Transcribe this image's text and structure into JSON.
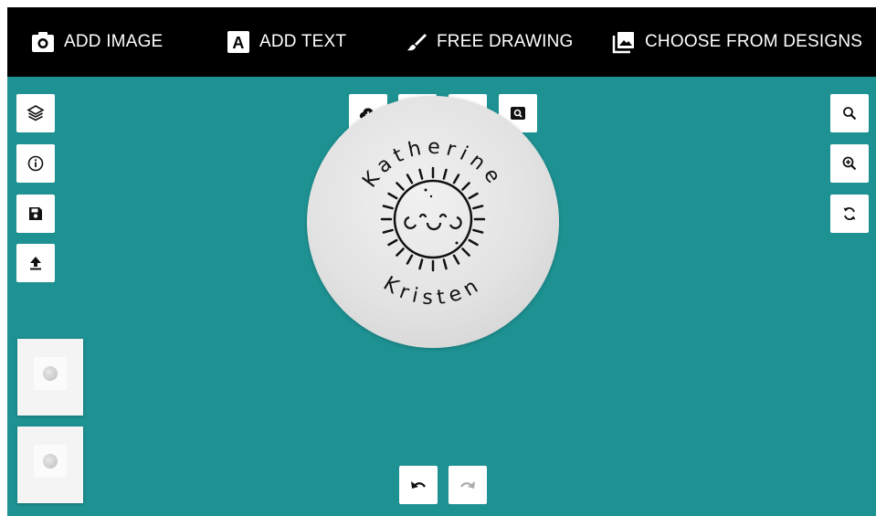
{
  "toolbar": {
    "add_image": "ADD IMAGE",
    "add_text": "ADD TEXT",
    "add_text_icon_letter": "A",
    "free_drawing": "FREE DRAWING",
    "choose_designs": "CHOOSE FROM DESIGNS"
  },
  "design": {
    "top_text": "Katherine",
    "bottom_text": "Kristen",
    "disc_color": "#e4e4e4",
    "canvas_color": "#1e9192"
  },
  "left_tools": [
    "layers-icon",
    "info-icon",
    "save-icon",
    "upload-icon"
  ],
  "top_tools": [
    "cloud-download-icon",
    "print-icon",
    "magnet-icon",
    "preview-icon"
  ],
  "right_tools": [
    "search-icon",
    "zoom-in-icon",
    "refresh-icon"
  ],
  "history": {
    "undo_enabled": true,
    "redo_enabled": false
  }
}
